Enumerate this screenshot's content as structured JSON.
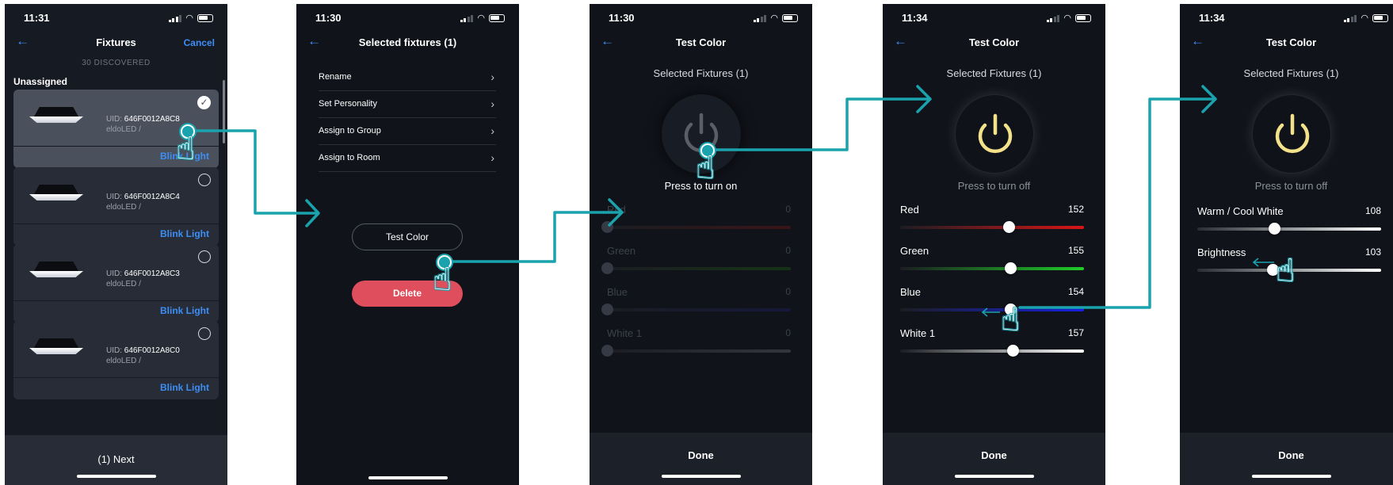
{
  "accent_color": "#1aa2ad",
  "link_color": "#3d8ef5",
  "screens": {
    "fixtures": {
      "status_time": "11:31",
      "back_icon": "back-arrow-icon",
      "title": "Fixtures",
      "cancel_label": "Cancel",
      "discovered": "30 DISCOVERED",
      "section": "Unassigned",
      "uid_label": "UID:",
      "cards": [
        {
          "uid": "646F0012A8C8",
          "brand": "eldoLED /",
          "blink": "Blink Light",
          "selected": true
        },
        {
          "uid": "646F0012A8C4",
          "brand": "eldoLED /",
          "blink": "Blink Light",
          "selected": false
        },
        {
          "uid": "646F0012A8C3",
          "brand": "eldoLED /",
          "blink": "Blink Light",
          "selected": false
        },
        {
          "uid": "646F0012A8C0",
          "brand": "eldoLED /",
          "blink": "Blink Light",
          "selected": false
        }
      ],
      "next_label": "(1) Next"
    },
    "selected": {
      "status_time": "11:30",
      "title": "Selected fixtures (1)",
      "menu": [
        {
          "label": "Rename"
        },
        {
          "label": "Set Personality"
        },
        {
          "label": "Assign to Group"
        },
        {
          "label": "Assign to Room"
        }
      ],
      "test_color_label": "Test Color",
      "delete_label": "Delete"
    },
    "test_off": {
      "status_time": "11:30",
      "title": "Test Color",
      "subtitle": "Selected Fixtures (1)",
      "press_label": "Press to turn on",
      "sliders": [
        {
          "name": "Red",
          "value": "0"
        },
        {
          "name": "Green",
          "value": "0"
        },
        {
          "name": "Blue",
          "value": "0"
        },
        {
          "name": "White 1",
          "value": "0"
        }
      ],
      "done_label": "Done"
    },
    "test_rgb": {
      "status_time": "11:34",
      "title": "Test Color",
      "subtitle": "Selected Fixtures (1)",
      "press_label": "Press to turn off",
      "sliders": [
        {
          "name": "Red",
          "value": "152",
          "fraction": 0.59
        },
        {
          "name": "Green",
          "value": "155",
          "fraction": 0.6
        },
        {
          "name": "Blue",
          "value": "154",
          "fraction": 0.6
        },
        {
          "name": "White 1",
          "value": "157",
          "fraction": 0.61
        }
      ],
      "done_label": "Done"
    },
    "test_white": {
      "status_time": "11:34",
      "title": "Test Color",
      "subtitle": "Selected Fixtures (1)",
      "press_label": "Press to turn off",
      "sliders": [
        {
          "name": "Warm / Cool White",
          "value": "108",
          "fraction": 0.42
        },
        {
          "name": "Brightness",
          "value": "103",
          "fraction": 0.41
        }
      ],
      "done_label": "Done"
    }
  }
}
